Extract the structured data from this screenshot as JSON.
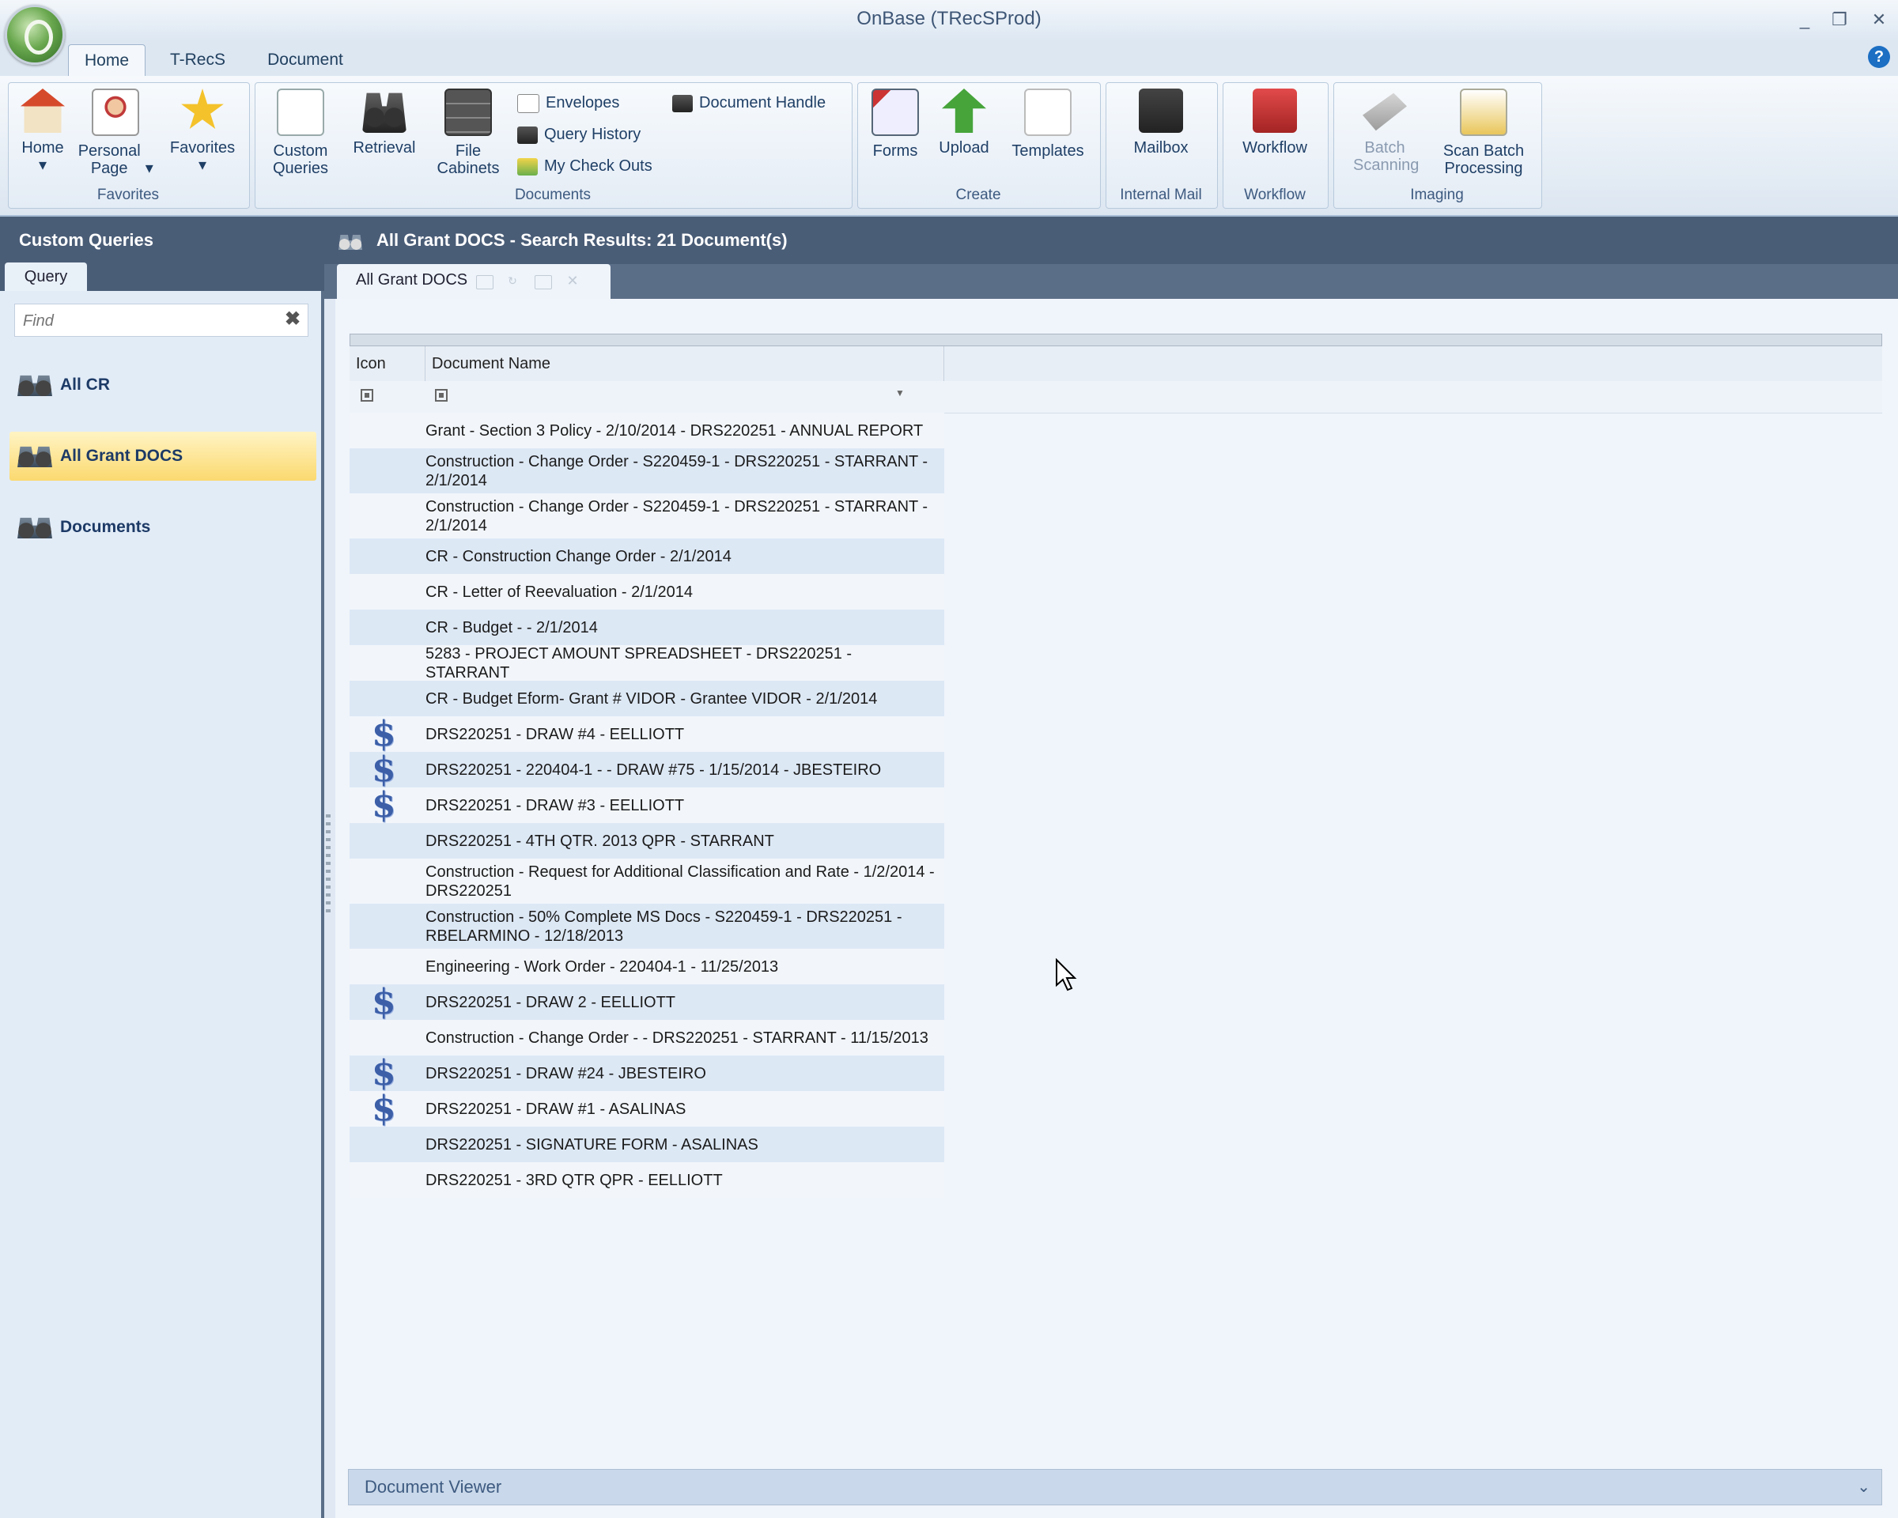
{
  "window": {
    "title": "OnBase (TRecSProd)",
    "minimize": "_",
    "restore": "❐",
    "close": "✕"
  },
  "tabs": [
    {
      "label": "Home",
      "active": true
    },
    {
      "label": "T-RecS",
      "active": false
    },
    {
      "label": "Document",
      "active": false
    }
  ],
  "help_label": "?",
  "ribbon": {
    "favorites": {
      "label": "Favorites",
      "buttons": [
        "Home",
        "Personal Page",
        "Favorites"
      ]
    },
    "documents": {
      "label": "Documents",
      "buttons": [
        "Custom Queries",
        "Retrieval",
        "File Cabinets"
      ],
      "small": [
        "Envelopes",
        "Query History",
        "My Check Outs",
        "Document Handle"
      ]
    },
    "create": {
      "label": "Create",
      "buttons": [
        "Forms",
        "Upload",
        "Templates"
      ]
    },
    "internal_mail": {
      "label": "Internal Mail",
      "buttons": [
        "Mailbox"
      ]
    },
    "workflow": {
      "label": "Workflow",
      "buttons": [
        "Workflow"
      ]
    },
    "imaging": {
      "label": "Imaging",
      "buttons": [
        "Batch Scanning",
        "Scan Batch Processing"
      ]
    }
  },
  "left_panel": {
    "title": "Custom Queries",
    "tab": "Query",
    "find_placeholder": "Find",
    "find_clear": "✖",
    "items": [
      {
        "label": "All CR",
        "selected": false
      },
      {
        "label": "All Grant DOCS",
        "selected": true
      },
      {
        "label": "Documents",
        "selected": false
      }
    ]
  },
  "main": {
    "header": "All Grant DOCS - Search Results: 21 Document(s)",
    "tab": "All Grant DOCS",
    "columns": [
      "Icon",
      "Document Name"
    ],
    "rows": [
      {
        "name": "Grant - Section 3 Policy - 2/10/2014 - DRS220251 - ANNUAL REPORT",
        "icon": ""
      },
      {
        "name": "Construction - Change Order - S220459-1 - DRS220251 - STARRANT - 2/1/2014",
        "icon": ""
      },
      {
        "name": "Construction - Change Order - S220459-1 - DRS220251 - STARRANT - 2/1/2014",
        "icon": ""
      },
      {
        "name": "CR - Construction Change Order - 2/1/2014",
        "icon": ""
      },
      {
        "name": "CR - Letter of Reevaluation - 2/1/2014",
        "icon": ""
      },
      {
        "name": "CR - Budget -  - 2/1/2014",
        "icon": ""
      },
      {
        "name": "5283 - PROJECT AMOUNT SPREADSHEET - DRS220251 - STARRANT",
        "icon": ""
      },
      {
        "name": "CR - Budget Eform- Grant # VIDOR - Grantee VIDOR - 2/1/2014",
        "icon": ""
      },
      {
        "name": "DRS220251 - DRAW #4 - EELLIOTT",
        "icon": "$"
      },
      {
        "name": "DRS220251 - 220404-1 -  - DRAW #75 - 1/15/2014 - JBESTEIRO",
        "icon": "$"
      },
      {
        "name": "DRS220251 - DRAW #3 - EELLIOTT",
        "icon": "$"
      },
      {
        "name": "DRS220251 - 4TH QTR. 2013 QPR - STARRANT",
        "icon": ""
      },
      {
        "name": "Construction - Request for Additional Classification and Rate - 1/2/2014 - DRS220251",
        "icon": ""
      },
      {
        "name": "Construction - 50% Complete MS Docs - S220459-1 - DRS220251 - RBELARMINO - 12/18/2013",
        "icon": ""
      },
      {
        "name": "Engineering - Work Order - 220404-1 - 11/25/2013",
        "icon": ""
      },
      {
        "name": "DRS220251 - DRAW 2 - EELLIOTT",
        "icon": "$"
      },
      {
        "name": "Construction - Change Order -  - DRS220251 - STARRANT - 11/15/2013",
        "icon": ""
      },
      {
        "name": "DRS220251 - DRAW #24 - JBESTEIRO",
        "icon": "$"
      },
      {
        "name": "DRS220251 - DRAW #1 - ASALINAS",
        "icon": "$"
      },
      {
        "name": "DRS220251 - SIGNATURE FORM - ASALINAS",
        "icon": ""
      },
      {
        "name": "DRS220251 - 3RD QTR QPR - EELLIOTT",
        "icon": ""
      }
    ],
    "viewer": "Document Viewer",
    "viewer_chevron": "⌄"
  }
}
